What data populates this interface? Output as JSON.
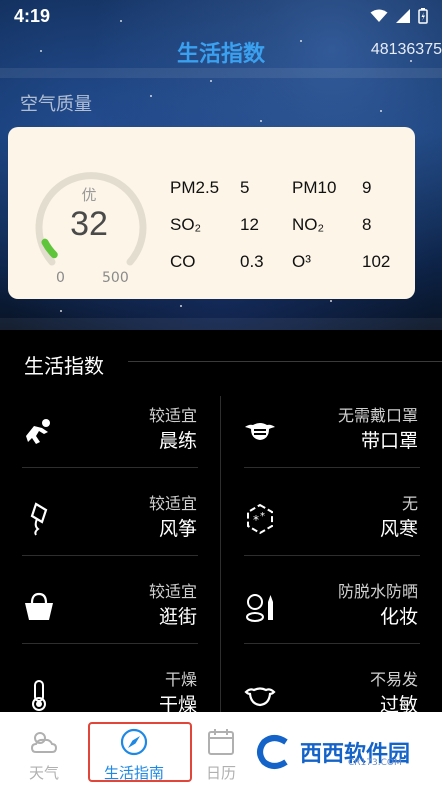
{
  "status_bar": {
    "time": "4:19"
  },
  "header": {
    "title": "生活指数",
    "id_text": "48136375"
  },
  "air_quality": {
    "section_label": "空气质量",
    "level": "优",
    "aqi": "32",
    "aqi_fraction": 0.064,
    "scale_min": "0",
    "scale_max": "500",
    "pollutants": [
      {
        "label": "PM2.5",
        "value": "5"
      },
      {
        "label": "PM10",
        "value": "9"
      },
      {
        "label": "SO₂",
        "value": "12"
      },
      {
        "label": "NO₂",
        "value": "8"
      },
      {
        "label": "CO",
        "value": "0.3"
      },
      {
        "label": "O³",
        "value": "102"
      }
    ]
  },
  "life_index": {
    "title": "生活指数",
    "items": [
      {
        "icon": "exercise-icon",
        "status": "较适宜",
        "name": "晨练"
      },
      {
        "icon": "mask-icon",
        "status": "无需戴口罩",
        "name": "带口罩"
      },
      {
        "icon": "kite-icon",
        "status": "较适宜",
        "name": "风筝"
      },
      {
        "icon": "wind-chill-icon",
        "status": "无",
        "name": "风寒"
      },
      {
        "icon": "shopping-basket-icon",
        "status": "较适宜",
        "name": "逛街"
      },
      {
        "icon": "makeup-icon",
        "status": "防脱水防晒",
        "name": "化妆"
      },
      {
        "icon": "thermometer-icon",
        "status": "干燥",
        "name": "干燥"
      },
      {
        "icon": "allergy-mask-icon",
        "status": "不易发",
        "name": "过敏"
      }
    ]
  },
  "bottom_nav": {
    "items": [
      {
        "label": "天气",
        "icon": "weather-icon"
      },
      {
        "label": "生活指南",
        "icon": "compass-icon"
      },
      {
        "label": "日历",
        "icon": "calendar-icon"
      }
    ]
  },
  "watermark": {
    "text": "西西软件园",
    "sub": "CR173.COM"
  }
}
